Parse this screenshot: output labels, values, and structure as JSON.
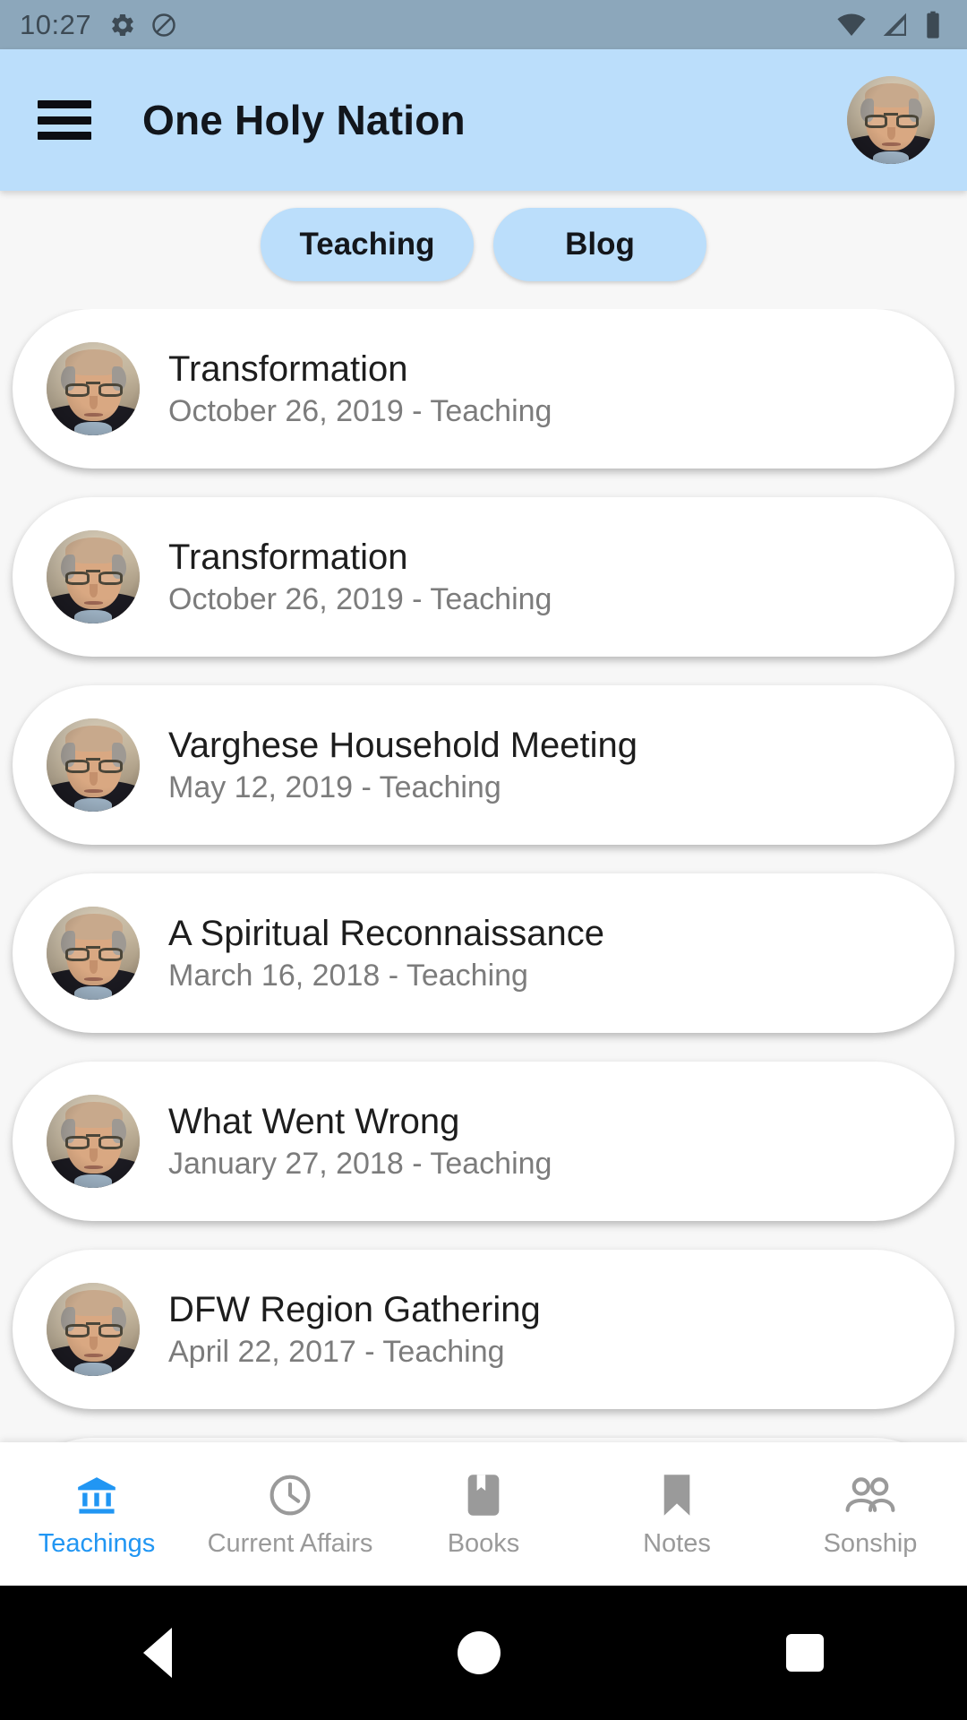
{
  "status_bar": {
    "time": "10:27",
    "left_icons": [
      "gear-icon",
      "do-not-disturb-icon"
    ],
    "right_icons": [
      "wifi-icon",
      "cell-signal-icon",
      "battery-icon"
    ],
    "background_color": "#8CA7BB"
  },
  "app_bar": {
    "menu_icon": "hamburger-menu-icon",
    "title": "One Holy Nation",
    "avatar": "profile-avatar",
    "background_color": "#BBDEFB"
  },
  "filters": {
    "pills": [
      {
        "label": "Teaching",
        "selected": true
      },
      {
        "label": "Blog",
        "selected": false
      }
    ],
    "pill_color": "#BBDEFB"
  },
  "list": {
    "items": [
      {
        "title": "Transformation",
        "subtitle": "October 26, 2019 - Teaching"
      },
      {
        "title": "Transformation",
        "subtitle": "October 26, 2019 - Teaching"
      },
      {
        "title": "Varghese Household Meeting",
        "subtitle": "May 12, 2019 - Teaching"
      },
      {
        "title": "A Spiritual Reconnaissance",
        "subtitle": "March 16, 2018 - Teaching"
      },
      {
        "title": "What Went Wrong",
        "subtitle": "January 27, 2018 - Teaching"
      },
      {
        "title": "DFW Region Gathering",
        "subtitle": "April 22, 2017 - Teaching"
      },
      {
        "title": "",
        "subtitle": ""
      }
    ]
  },
  "bottom_nav": {
    "active_color": "#2196F3",
    "inactive_color": "#9A9A9A",
    "items": [
      {
        "label": "Teachings",
        "icon": "bank-columns-icon",
        "active": true
      },
      {
        "label": "Current Affairs",
        "icon": "clock-icon",
        "active": false
      },
      {
        "label": "Books",
        "icon": "book-bookmark-icon",
        "active": false
      },
      {
        "label": "Notes",
        "icon": "bookmark-icon",
        "active": false
      },
      {
        "label": "Sonship",
        "icon": "people-group-icon",
        "active": false
      }
    ]
  },
  "system_nav": {
    "back": "back-triangle-icon",
    "home": "home-circle-icon",
    "recents": "recents-square-icon"
  }
}
